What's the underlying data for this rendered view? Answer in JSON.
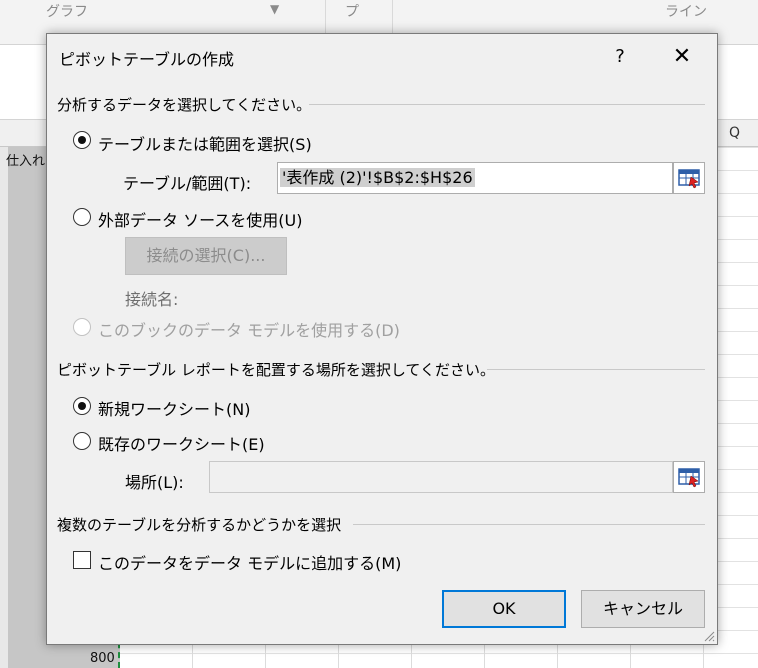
{
  "background": {
    "ribbon_labels": {
      "graph": "グラフ",
      "pivot_fragment": "プ",
      "line": "ライン"
    },
    "column_q": "Q",
    "cell_header": "仕入れ",
    "cell_value": "800"
  },
  "dialog": {
    "title": "ピボットテーブルの作成",
    "help": "?",
    "close": "✕",
    "section1": "分析するデータを選択してください。",
    "opt_table": "テーブルまたは範囲を選択(S)",
    "range_label": "テーブル/範囲(T):",
    "range_value": "'表作成 (2)'!$B$2:$H$26",
    "opt_external": "外部データ ソースを使用(U)",
    "choose_connection": "接続の選択(C)...",
    "connection_name": "接続名:",
    "opt_datamodel": "このブックのデータ モデルを使用する(D)",
    "section2": "ピボットテーブル レポートを配置する場所を選択してください。",
    "opt_new_sheet": "新規ワークシート(N)",
    "opt_existing_sheet": "既存のワークシート(E)",
    "location_label": "場所(L):",
    "location_value": "",
    "section3": "複数のテーブルを分析するかどうかを選択",
    "add_to_model": "このデータをデータ モデルに追加する(M)",
    "ok": "OK",
    "cancel": "キャンセル"
  }
}
